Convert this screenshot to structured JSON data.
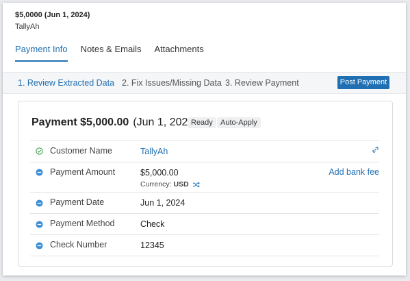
{
  "header": {
    "title": "$5,0000 (Jun 1, 2024)",
    "customer": "TallyAh"
  },
  "tabs": [
    {
      "label": "Payment Info",
      "active": true
    },
    {
      "label": "Notes & Emails",
      "active": false
    },
    {
      "label": "Attachments",
      "active": false
    }
  ],
  "steps": [
    {
      "label": "1. Review Extracted Data",
      "active": true
    },
    {
      "label": "2. Fix Issues/Missing Data",
      "active": false
    },
    {
      "label": "3. Review Payment",
      "active": false
    }
  ],
  "post_button_label": "Post Payment",
  "card": {
    "title_amount": "Payment $5,000.00",
    "title_date": "(Jun 1, 2024)",
    "status_pill": "Ready",
    "mode_pill": "Auto-Apply",
    "rows": [
      {
        "label": "Customer Name",
        "value": "TallyAh",
        "status_icon": "check-circle-icon"
      },
      {
        "label": "Payment Amount",
        "value": "$5,000.00",
        "currency_label": "Currency:",
        "currency_value": "USD",
        "action": "Add bank fee",
        "status_icon": "minus-circle-icon"
      },
      {
        "label": "Payment Date",
        "value": "Jun 1, 2024",
        "status_icon": "minus-circle-icon"
      },
      {
        "label": "Payment Method",
        "value": "Check",
        "status_icon": "minus-circle-icon"
      },
      {
        "label": "Check Number",
        "value": "12345",
        "status_icon": "minus-circle-icon"
      }
    ]
  },
  "colors": {
    "accent": "#1f6fb2",
    "success": "#3a9a4a",
    "info_icon": "#3b8fd6"
  }
}
